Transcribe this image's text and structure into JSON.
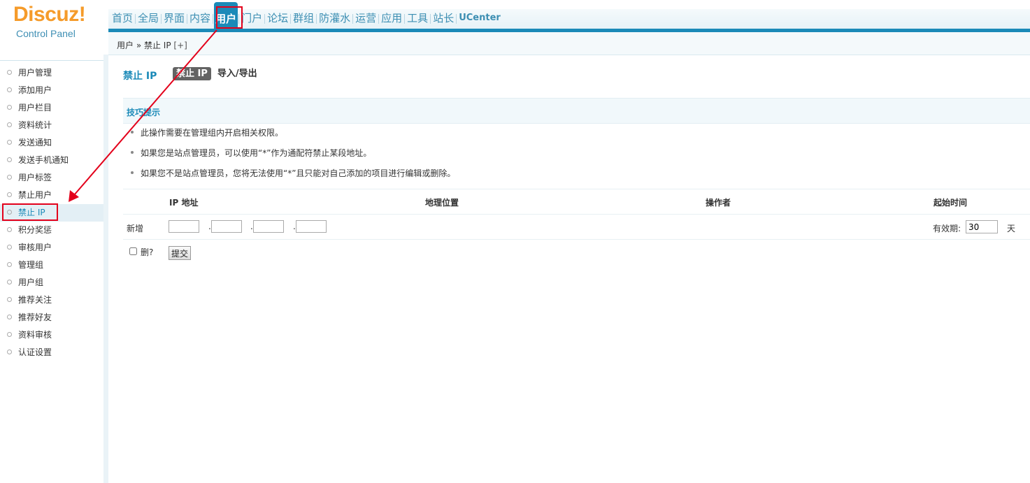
{
  "logo": {
    "brand": "Discuz",
    "bang": "!",
    "sub": "Control Panel"
  },
  "nav": {
    "items": [
      "首页",
      "全局",
      "界面",
      "内容",
      "用户",
      "门户",
      "论坛",
      "群组",
      "防灌水",
      "运营",
      "应用",
      "工具",
      "站长",
      "UCenter"
    ],
    "active": "用户"
  },
  "breadcrumb": {
    "text": "用户 » 禁止 IP",
    "add": "[+]"
  },
  "sidebar": {
    "items": [
      "用户管理",
      "添加用户",
      "用户栏目",
      "资料统计",
      "发送通知",
      "发送手机通知",
      "用户标签",
      "禁止用户",
      "禁止 IP",
      "积分奖惩",
      "审核用户",
      "管理组",
      "用户组",
      "推荐关注",
      "推荐好友",
      "资料审核",
      "认证设置"
    ],
    "active": "禁止 IP"
  },
  "page": {
    "title": "禁止 IP",
    "tabs": {
      "current": "禁止 IP",
      "other": "导入/导出"
    }
  },
  "tips": {
    "heading": "技巧提示",
    "items": [
      "此操作需要在管理组内开启相关权限。",
      "如果您是站点管理员，可以使用“*”作为通配符禁止某段地址。",
      "如果您不是站点管理员，您将无法使用“*”且只能对自己添加的项目进行编辑或删除。"
    ]
  },
  "table": {
    "headers": {
      "ip": "IP 地址",
      "location": "地理位置",
      "operator": "操作者",
      "start": "起始时间"
    },
    "new_label": "新增",
    "ip_dot": ".",
    "valid_label": "有效期:",
    "valid_value": "30",
    "day_unit": "天",
    "delete_label": "删?",
    "submit_label": "提交"
  },
  "colors": {
    "accent": "#1b8ab8",
    "highlight": "#e3001b",
    "logo": "#f59b2a"
  }
}
